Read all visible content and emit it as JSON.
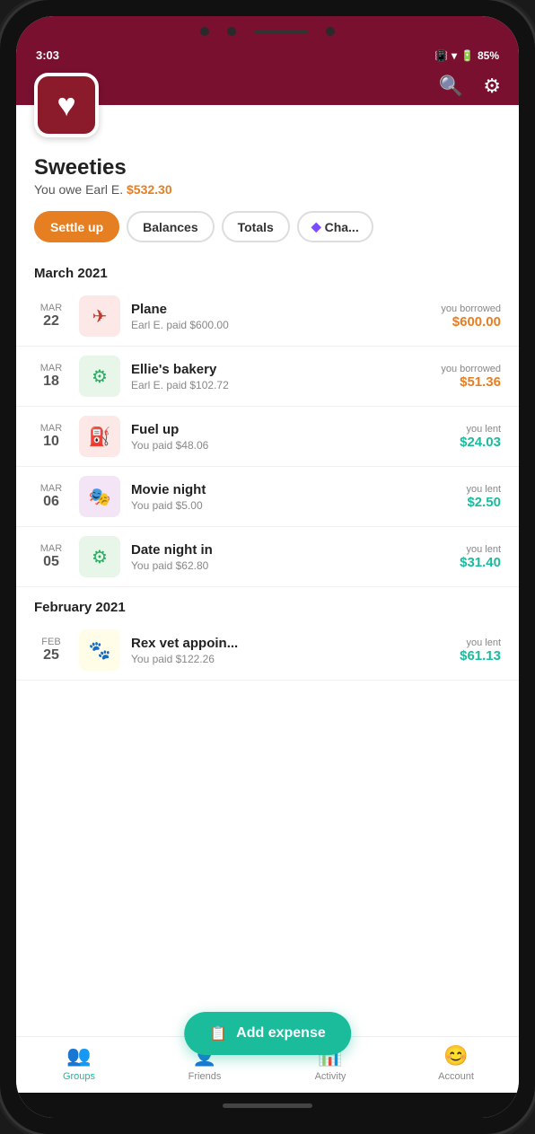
{
  "status": {
    "time": "3:03",
    "battery": "85%",
    "signal": "▐"
  },
  "header": {
    "back_label": "←",
    "search_label": "🔍",
    "settings_label": "⚙"
  },
  "group": {
    "name": "Sweeties",
    "owe_text": "You owe Earl E.",
    "owe_amount": "$532.30"
  },
  "tabs": {
    "settle": "Settle up",
    "balances": "Balances",
    "totals": "Totals",
    "charts": "Cha..."
  },
  "sections": [
    {
      "month": "March 2021",
      "items": [
        {
          "month": "Mar",
          "day": "22",
          "icon": "✈",
          "icon_bg": "pink",
          "name": "Plane",
          "paid": "Earl E. paid $600.00",
          "label": "you borrowed",
          "amount": "$600.00",
          "type": "borrowed"
        },
        {
          "month": "Mar",
          "day": "18",
          "icon": "🍴",
          "icon_bg": "green",
          "name": "Ellie's bakery",
          "paid": "Earl E. paid $102.72",
          "label": "you borrowed",
          "amount": "$51.36",
          "type": "borrowed"
        },
        {
          "month": "Mar",
          "day": "10",
          "icon": "⛽",
          "icon_bg": "pink",
          "name": "Fuel up",
          "paid": "You paid $48.06",
          "label": "you lent",
          "amount": "$24.03",
          "type": "lent"
        },
        {
          "month": "Mar",
          "day": "06",
          "icon": "🎬",
          "icon_bg": "purple",
          "name": "Movie night",
          "paid": "You paid $5.00",
          "label": "you lent",
          "amount": "$2.50",
          "type": "lent"
        },
        {
          "month": "Mar",
          "day": "05",
          "icon": "🍴",
          "icon_bg": "green",
          "name": "Date night in",
          "paid": "You paid $62.80",
          "label": "you lent",
          "amount": "$31.40",
          "type": "lent"
        }
      ]
    },
    {
      "month": "February 2021",
      "items": [
        {
          "month": "Feb",
          "day": "25",
          "icon": "🐾",
          "icon_bg": "yellow",
          "name": "Rex vet appoin...",
          "paid": "You paid $122.26",
          "label": "you lent",
          "amount": "$61.13",
          "type": "lent"
        }
      ]
    }
  ],
  "add_expense": {
    "icon": "📋",
    "label": "Add expense"
  },
  "nav": {
    "items": [
      {
        "icon": "👥",
        "label": "Groups",
        "active": true
      },
      {
        "icon": "👤",
        "label": "Friends",
        "active": false
      },
      {
        "icon": "📊",
        "label": "Activity",
        "active": false
      },
      {
        "icon": "😊",
        "label": "Account",
        "active": false
      }
    ]
  }
}
